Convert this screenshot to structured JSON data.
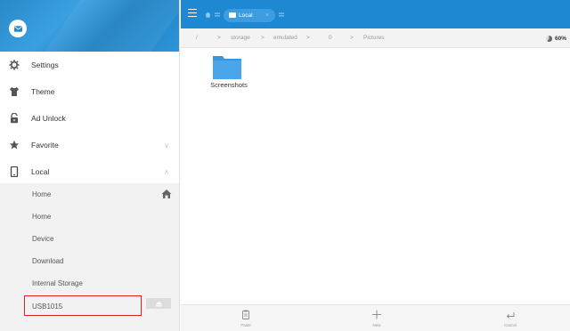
{
  "sidebar": {
    "menu": [
      {
        "label": "Settings",
        "icon": "gear-icon"
      },
      {
        "label": "Theme",
        "icon": "shirt-icon"
      },
      {
        "label": "Ad Unlock",
        "icon": "unlock-icon"
      },
      {
        "label": "Favorite",
        "icon": "star-icon",
        "arrow": "∨"
      },
      {
        "label": "Local",
        "icon": "phone-icon",
        "arrow": "∧"
      }
    ],
    "local_items": [
      "Home",
      "Home",
      "Device",
      "Download",
      "Internal Storage",
      "USB1015"
    ]
  },
  "topbar": {
    "tab_label": "Local",
    "tab_close": "×"
  },
  "breadcrumb": {
    "parts": [
      "/",
      ">",
      "storage",
      ">",
      "emulated",
      ">",
      "0",
      ">",
      "Pictures"
    ],
    "storage_percent": "60%"
  },
  "files": [
    {
      "name": "Screenshots",
      "type": "folder"
    }
  ],
  "bottombar": {
    "paste": "Paste",
    "new": "New",
    "cancel": "Cancel"
  },
  "colors": {
    "accent": "#1e88d2",
    "highlight": "#e02222"
  }
}
